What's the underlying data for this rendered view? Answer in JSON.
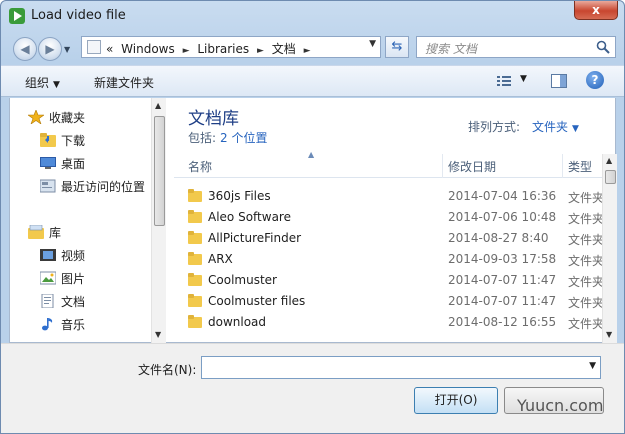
{
  "window": {
    "title": "Load video file",
    "close_label": "x"
  },
  "address": {
    "crumbs": [
      "«",
      "Windows",
      "Libraries",
      "文档"
    ],
    "separator": "►"
  },
  "search": {
    "placeholder": "搜索 文档"
  },
  "toolbar": {
    "organize_label": "组织",
    "new_folder_label": "新建文件夹",
    "help_label": "?"
  },
  "sidebar": {
    "items": [
      {
        "label": "收藏夹",
        "icon": "star-icon"
      },
      {
        "label": "下载",
        "icon": "downloads-folder-icon"
      },
      {
        "label": "桌面",
        "icon": "desktop-icon"
      },
      {
        "label": "最近访问的位置",
        "icon": "recent-places-icon"
      },
      {
        "label": "库",
        "icon": "libraries-icon"
      },
      {
        "label": "视频",
        "icon": "videos-icon"
      },
      {
        "label": "图片",
        "icon": "pictures-icon"
      },
      {
        "label": "文档",
        "icon": "documents-icon"
      },
      {
        "label": "音乐",
        "icon": "music-icon"
      }
    ]
  },
  "library": {
    "title": "文档库",
    "includes_label": "包括:",
    "includes_link": "2 个位置",
    "arrange_label": "排列方式:",
    "arrange_value": "文件夹"
  },
  "columns": {
    "name": "名称",
    "date": "修改日期",
    "type": "类型"
  },
  "files": [
    {
      "name": "360js Files",
      "date": "2014-07-04 16:36",
      "type": "文件夹"
    },
    {
      "name": "Aleo Software",
      "date": "2014-07-06 10:48",
      "type": "文件夹"
    },
    {
      "name": "AllPictureFinder",
      "date": "2014-08-27 8:40",
      "type": "文件夹"
    },
    {
      "name": "ARX",
      "date": "2014-09-03 17:58",
      "type": "文件夹"
    },
    {
      "name": "Coolmuster",
      "date": "2014-07-07 11:47",
      "type": "文件夹"
    },
    {
      "name": "Coolmuster files",
      "date": "2014-07-07 11:47",
      "type": "文件夹"
    },
    {
      "name": "download",
      "date": "2014-08-12 16:55",
      "type": "文件夹"
    }
  ],
  "footer": {
    "filename_label": "文件名(N):",
    "filename_value": "",
    "open_label": "打开(O)",
    "watermark": "Yuucn.com"
  }
}
